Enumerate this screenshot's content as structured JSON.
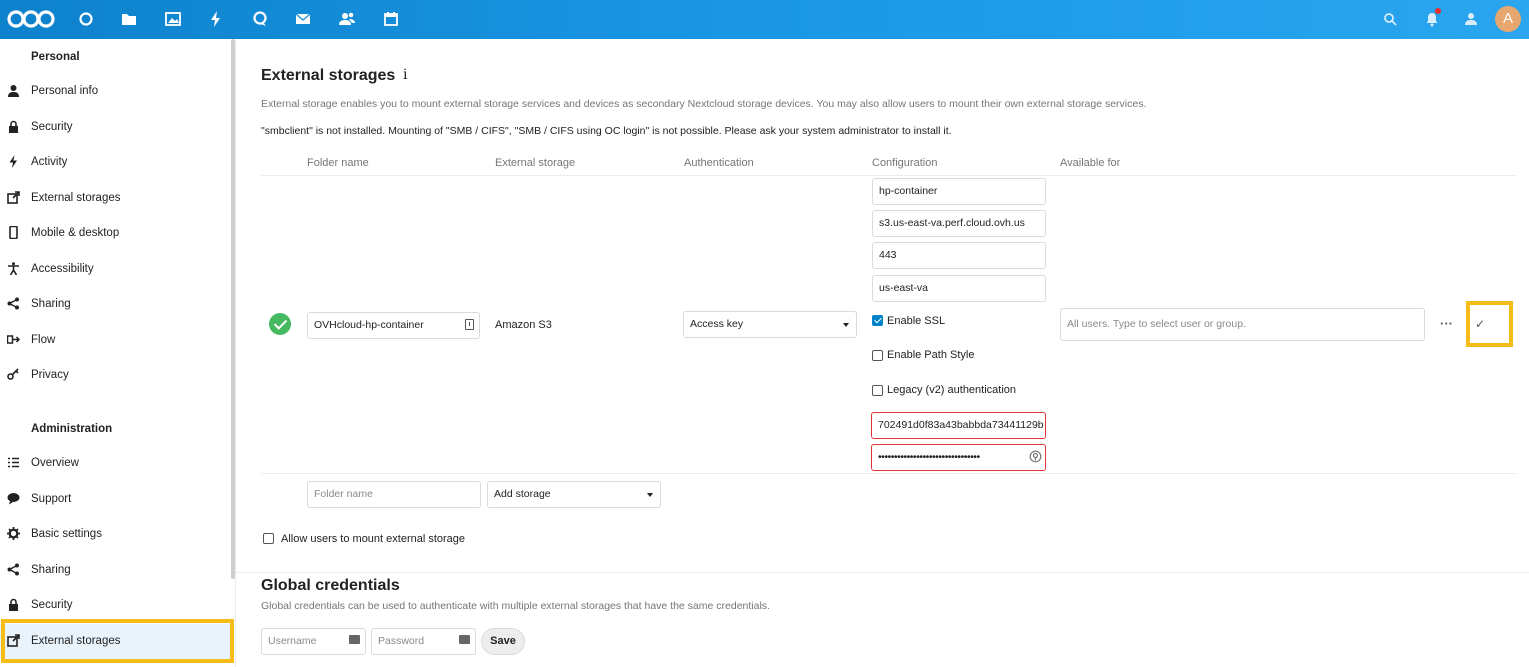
{
  "header": {
    "apps": [
      "dashboard-icon",
      "files-icon",
      "photos-icon",
      "activity-icon",
      "talk-icon",
      "mail-icon",
      "contacts-icon",
      "calendar-icon"
    ],
    "right_icons": [
      "search-icon",
      "notifications-icon",
      "contacts-menu-icon"
    ],
    "avatar_initial": "A",
    "brand_color": "#0082c9"
  },
  "sidebar": {
    "personal_heading": "Personal",
    "personal_items": [
      {
        "label": "Personal info",
        "icon": "user-icon"
      },
      {
        "label": "Security",
        "icon": "lock-icon"
      },
      {
        "label": "Activity",
        "icon": "activity-icon"
      },
      {
        "label": "External storages",
        "icon": "external-icon"
      },
      {
        "label": "Mobile & desktop",
        "icon": "phone-icon"
      },
      {
        "label": "Accessibility",
        "icon": "accessibility-icon"
      },
      {
        "label": "Sharing",
        "icon": "share-icon"
      },
      {
        "label": "Flow",
        "icon": "flow-icon"
      },
      {
        "label": "Privacy",
        "icon": "key-icon"
      }
    ],
    "admin_heading": "Administration",
    "admin_items": [
      {
        "label": "Overview",
        "icon": "list-icon"
      },
      {
        "label": "Support",
        "icon": "speech-icon"
      },
      {
        "label": "Basic settings",
        "icon": "gear-icon"
      },
      {
        "label": "Sharing",
        "icon": "share-icon"
      },
      {
        "label": "Security",
        "icon": "lock-icon"
      },
      {
        "label": "External storages",
        "icon": "external-icon"
      }
    ]
  },
  "external": {
    "title": "External storages",
    "info_glyph": "i",
    "description": "External storage enables you to mount external storage services and devices as secondary Nextcloud storage devices. You may also allow users to mount their own external storage services.",
    "warning": "\"smbclient\" is not installed. Mounting of \"SMB / CIFS\", \"SMB / CIFS using OC login\" is not possible. Please ask your system administrator to install it.",
    "columns": {
      "folder": "Folder name",
      "storage": "External storage",
      "auth": "Authentication",
      "config": "Configuration",
      "available": "Available for"
    },
    "row": {
      "folder_name": "OVHcloud-hp-container",
      "storage": "Amazon S3",
      "auth": "Access key",
      "bucket": "hp-container",
      "hostname": "s3.us-east-va.perf.cloud.ovh.us",
      "port": "443",
      "region": "us-east-va",
      "enable_ssl": "Enable SSL",
      "enable_path_style": "Enable Path Style",
      "legacy_auth": "Legacy (v2) authentication",
      "access_key": "702491d0f83a43babbda73441129b",
      "secret": "••••••••••••••••••••••••••••••••",
      "available_placeholder": "All users. Type to select user or group.",
      "more": "···",
      "confirm": "✓"
    },
    "new_row": {
      "folder_placeholder": "Folder name",
      "add_storage": "Add storage"
    },
    "allow_users": "Allow users to mount external storage"
  },
  "global": {
    "title": "Global credentials",
    "description": "Global credentials can be used to authenticate with multiple external storages that have the same credentials.",
    "username_placeholder": "Username",
    "password_placeholder": "Password",
    "save": "Save"
  }
}
